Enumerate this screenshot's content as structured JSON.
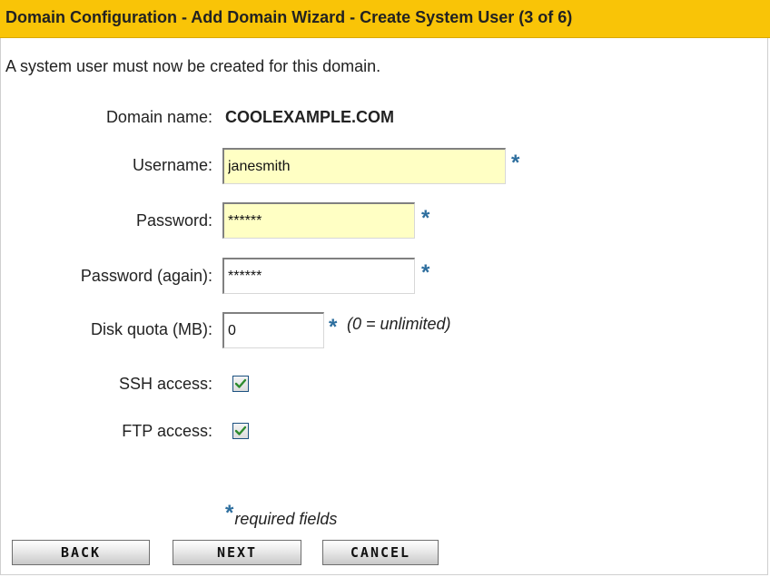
{
  "header": {
    "title": "Domain Configuration - Add Domain Wizard - Create System User (3 of 6)"
  },
  "intro_text": "A system user must now be created for this domain.",
  "form": {
    "domain_name": {
      "label": "Domain name:",
      "value": "COOLEXAMPLE.COM"
    },
    "username": {
      "label": "Username:",
      "value": "janesmith",
      "required": true
    },
    "password": {
      "label": "Password:",
      "value": "******",
      "required": true
    },
    "password_again": {
      "label": "Password (again):",
      "value": "******",
      "required": true
    },
    "disk_quota": {
      "label": "Disk quota (MB):",
      "value": "0",
      "required": true,
      "hint": "(0 = unlimited)"
    },
    "ssh_access": {
      "label": "SSH access:",
      "checked": true
    },
    "ftp_access": {
      "label": "FTP access:",
      "checked": true
    },
    "required_marker": "*",
    "required_note": "required fields"
  },
  "buttons": {
    "back": "BACK",
    "next": "NEXT",
    "cancel": "CANCEL"
  },
  "colors": {
    "header_background": "#f9c407",
    "highlight_field": "#ffffc4",
    "required_marker": "#2d6e9e",
    "checkmark": "#2e8b2e"
  }
}
